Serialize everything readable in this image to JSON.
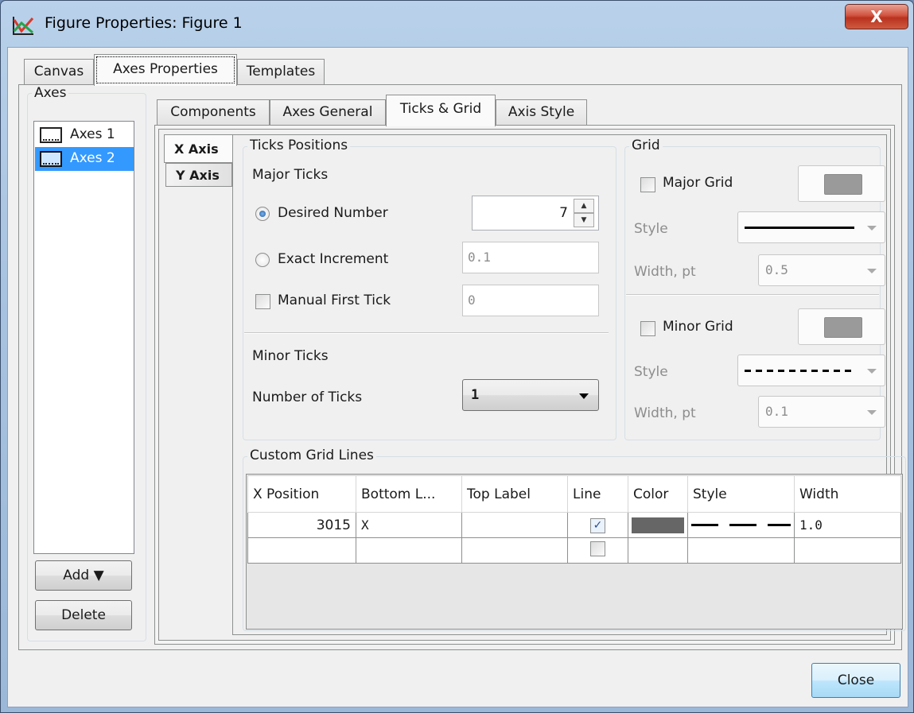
{
  "window": {
    "title": "Figure Properties: Figure 1",
    "close_glyph": "X",
    "icon": "chart-icon"
  },
  "top_tabs": [
    {
      "label": "Canvas"
    },
    {
      "label": "Axes Properties"
    },
    {
      "label": "Templates"
    }
  ],
  "axes_panel": {
    "title": "Axes",
    "items": [
      {
        "label": "Axes 1",
        "selected": false
      },
      {
        "label": "Axes 2",
        "selected": true
      }
    ],
    "add_label": "Add ▼",
    "delete_label": "Delete"
  },
  "sub_tabs": [
    {
      "label": "Components"
    },
    {
      "label": "Axes General"
    },
    {
      "label": "Ticks & Grid"
    },
    {
      "label": "Axis Style"
    }
  ],
  "axis_tabs": [
    {
      "label": "X Axis"
    },
    {
      "label": "Y Axis"
    }
  ],
  "ticks_positions": {
    "title": "Ticks Positions",
    "major_ticks_label": "Major Ticks",
    "desired_number_label": "Desired Number",
    "desired_number_value": "7",
    "exact_increment_label": "Exact Increment",
    "exact_increment_value": "0.1",
    "manual_first_tick_label": "Manual First Tick",
    "manual_first_tick_value": "0",
    "minor_ticks_label": "Minor Ticks",
    "number_of_ticks_label": "Number of Ticks",
    "number_of_ticks_value": "1"
  },
  "grid": {
    "title": "Grid",
    "major_label": "Major Grid",
    "minor_label": "Minor Grid",
    "style_label": "Style",
    "width_label": "Width, pt",
    "major_width": "0.5",
    "minor_width": "0.1",
    "swatch_color": "#9a9a9a"
  },
  "custom_grid": {
    "title": "Custom Grid Lines",
    "columns": [
      "X Position",
      "Bottom L...",
      "Top Label",
      "Line",
      "Color",
      "Style",
      "Width"
    ],
    "rows": [
      {
        "x_position": "3015",
        "bottom": "X",
        "top": "",
        "line": true,
        "color": "#666666",
        "width": "1.0"
      },
      {
        "x_position": "",
        "bottom": "",
        "top": "",
        "line": false,
        "color": "",
        "width": ""
      }
    ]
  },
  "close_label": "Close"
}
